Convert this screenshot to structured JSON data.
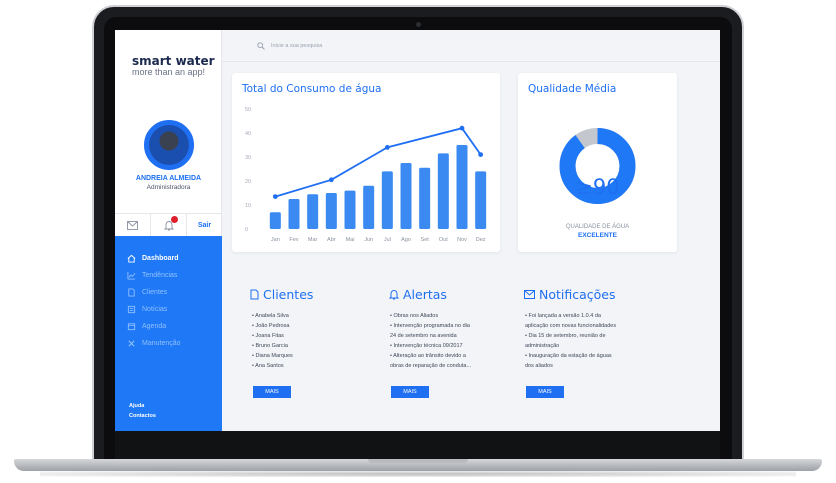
{
  "brand": {
    "title": "smart water",
    "subtitle": "more than an app!"
  },
  "user": {
    "name": "ANDREIA ALMEIDA",
    "role": "Administradora"
  },
  "actions": {
    "notification_count_shown": true,
    "logout_label": "Sair"
  },
  "nav": {
    "items": [
      {
        "label": "Dashboard",
        "icon": "home-icon",
        "active": true
      },
      {
        "label": "Tendências",
        "icon": "trend-icon",
        "active": false
      },
      {
        "label": "Clientes",
        "icon": "document-icon",
        "active": false
      },
      {
        "label": "Notícias",
        "icon": "newspaper-icon",
        "active": false
      },
      {
        "label": "Agenda",
        "icon": "calendar-icon",
        "active": false
      },
      {
        "label": "Manutenção",
        "icon": "tools-icon",
        "active": false
      }
    ],
    "footer": [
      "Ajuda",
      "Contactos"
    ]
  },
  "search": {
    "placeholder": "Inicie a sua pesquisa"
  },
  "consumption": {
    "title": "Total do Consumo de água",
    "chart_data": {
      "type": "bar",
      "categories": [
        "Jan",
        "Fev",
        "Mar",
        "Abr",
        "Mai",
        "Jun",
        "Jul",
        "Ago",
        "Set",
        "Out",
        "Nov",
        "Dez"
      ],
      "values": [
        7,
        12.5,
        14.5,
        15,
        16,
        18,
        24,
        27.5,
        25.5,
        31.5,
        35,
        24
      ],
      "line_points": [
        {
          "x": "Jan",
          "y": 13.5
        },
        {
          "x": "Abr",
          "y": 20.5
        },
        {
          "x": "Jul",
          "y": 34
        },
        {
          "x": "Nov",
          "y": 42
        },
        {
          "x": "Dez",
          "y": 31
        }
      ],
      "yticks": [
        0,
        10,
        20,
        30,
        40,
        50
      ],
      "ylim": [
        0,
        50
      ],
      "grid": false,
      "colors": {
        "bar": "#3b8af2",
        "line": "#1f6ff2"
      }
    }
  },
  "quality": {
    "title": "Qualidade Média",
    "value": "≥90",
    "caption": "QUALIDADE DE ÁGUA",
    "rating": "EXCELENTE",
    "gauge_fraction": 0.9,
    "colors": {
      "fill": "#1f78f5",
      "rest": "#c4c8ce"
    }
  },
  "panels": [
    {
      "title": "Clientes",
      "icon": "document-icon",
      "items": [
        "Anabela Silva",
        "João Pedrosa",
        "Joana Fitas",
        "Bruno Garcia",
        "Diana Marques",
        "Ana Santos"
      ],
      "button": "MAIS"
    },
    {
      "title": "Alertas",
      "icon": "bell-icon",
      "items": [
        "Obras nos Aliados",
        "Intervenção programada no dia",
        "24 de setembro na avenida",
        "Intervenção técnica 09/2017",
        "Alteração ao trânsito devido a",
        "obras de reparação de conduta..."
      ],
      "button": "MAIS"
    },
    {
      "title": "Notificações",
      "icon": "envelope-icon",
      "items": [
        "Foi lançada a versão 1.0.4 da",
        "aplicação com novas funcionalidades",
        "Dia 15 de setembro, reunião de",
        "administração",
        "Inauguração da estação de águas",
        "dos aliados"
      ],
      "button": "MAIS"
    }
  ]
}
